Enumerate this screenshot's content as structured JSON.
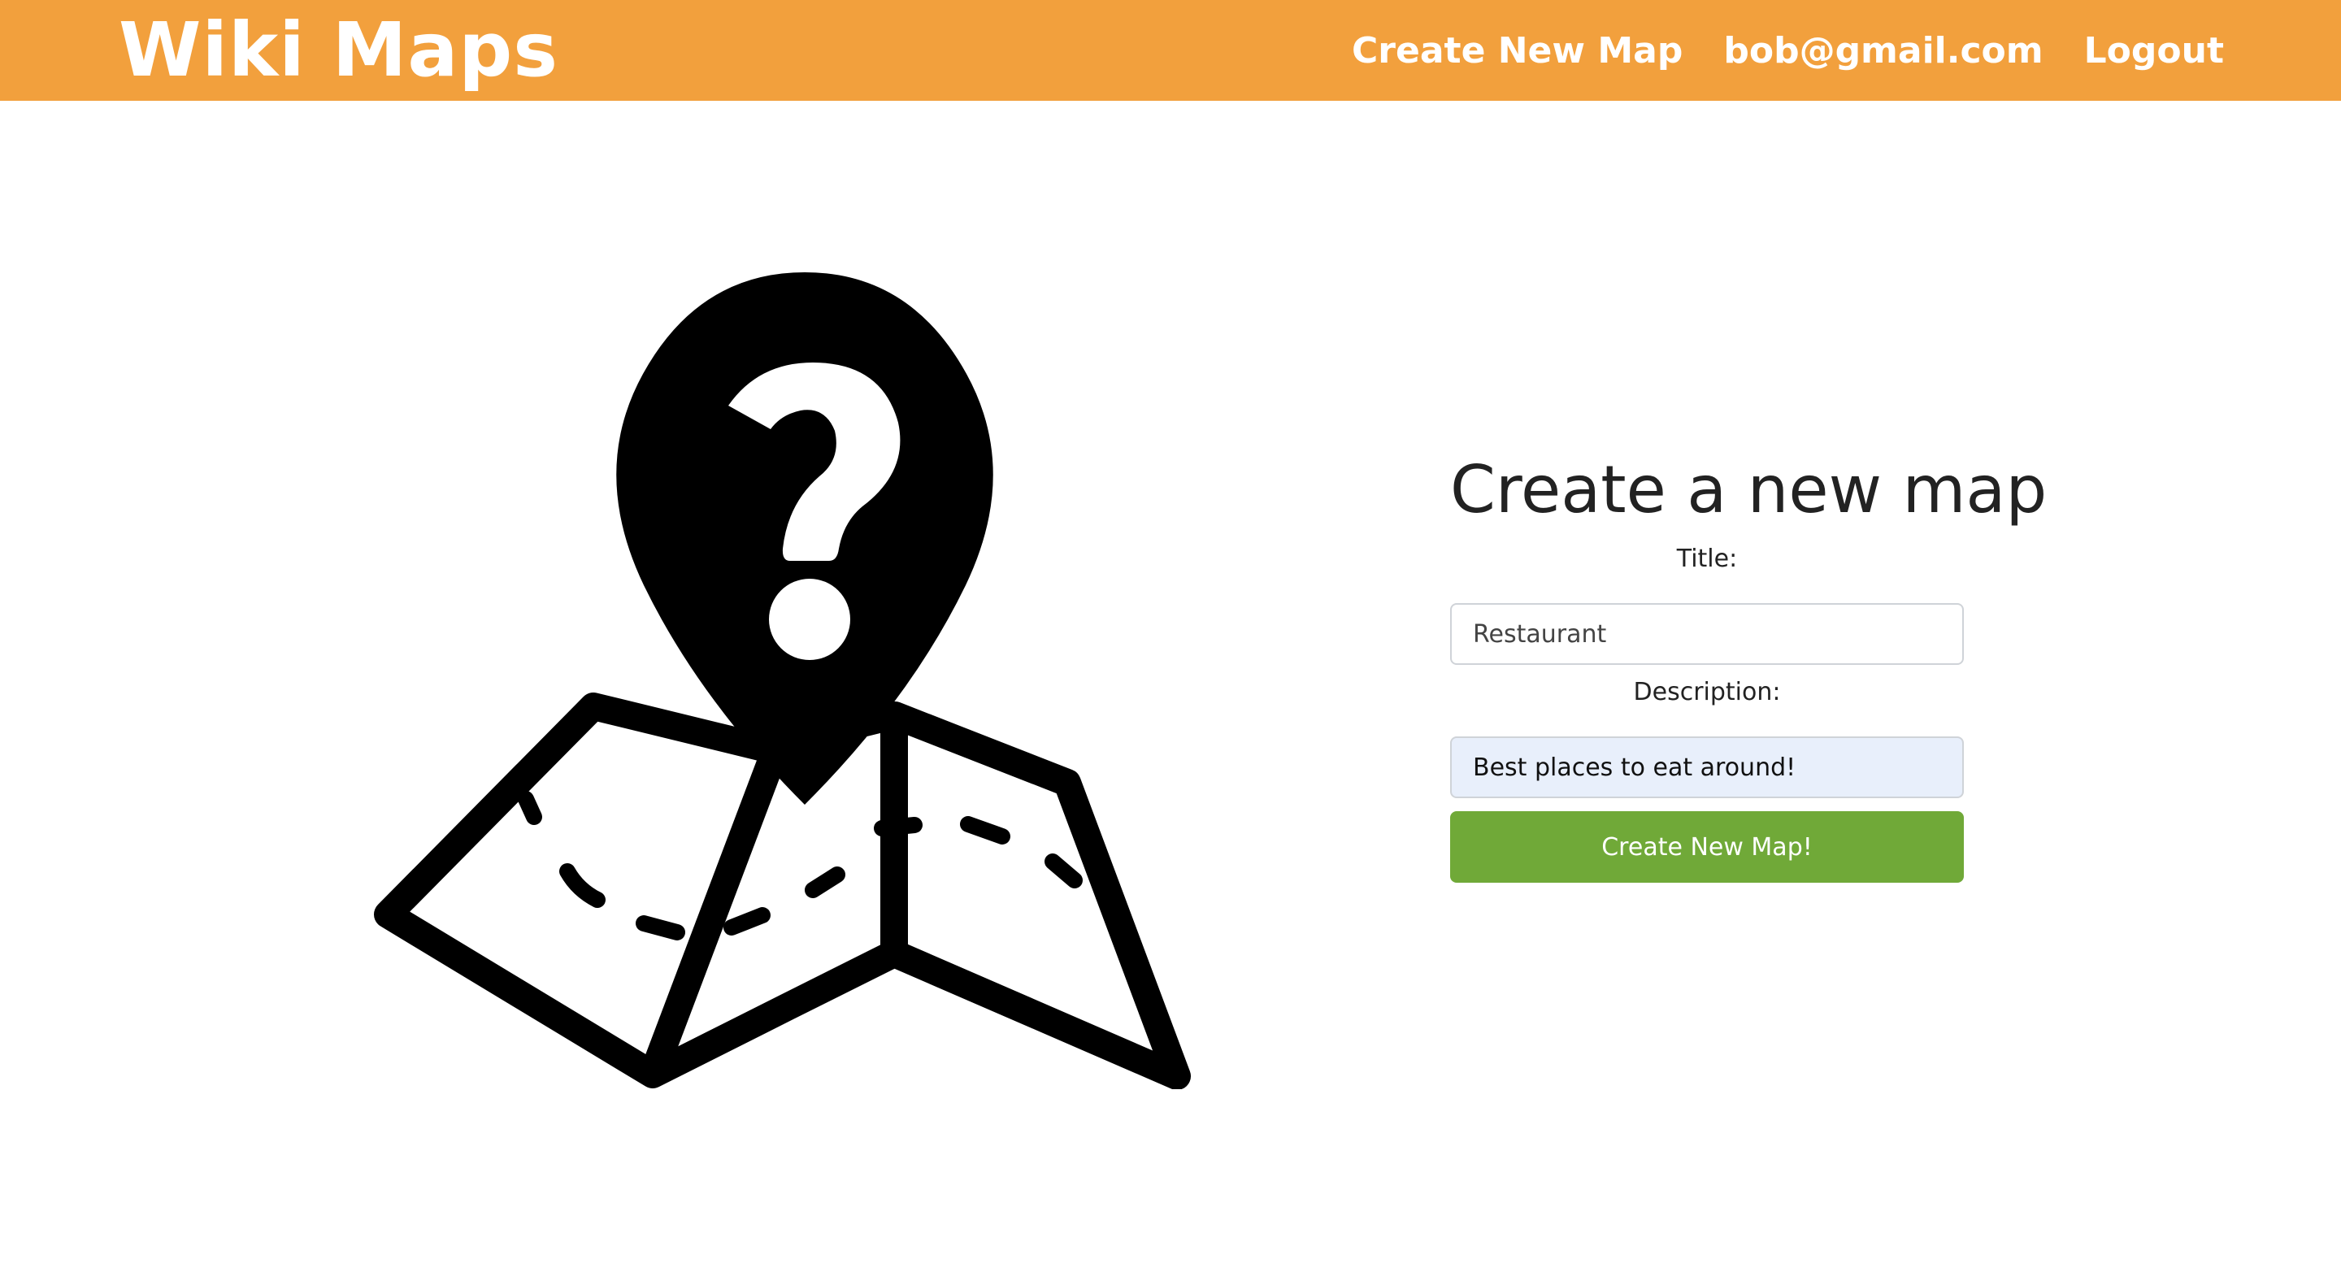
{
  "navbar": {
    "brand": "Wiki Maps",
    "links": {
      "create_map": "Create New Map",
      "user_email": "bob@gmail.com",
      "logout": "Logout"
    }
  },
  "hero": {
    "icon": "map-pin-question-icon"
  },
  "form": {
    "heading": "Create a new map",
    "title_label": "Title:",
    "title_value": "Restaurant",
    "description_label": "Description:",
    "description_value": "Best places to eat around!",
    "submit_label": "Create New Map!"
  },
  "colors": {
    "navbar": "#f2a03d",
    "submit_button": "#70a938",
    "autofill_field": "#e8effb"
  }
}
